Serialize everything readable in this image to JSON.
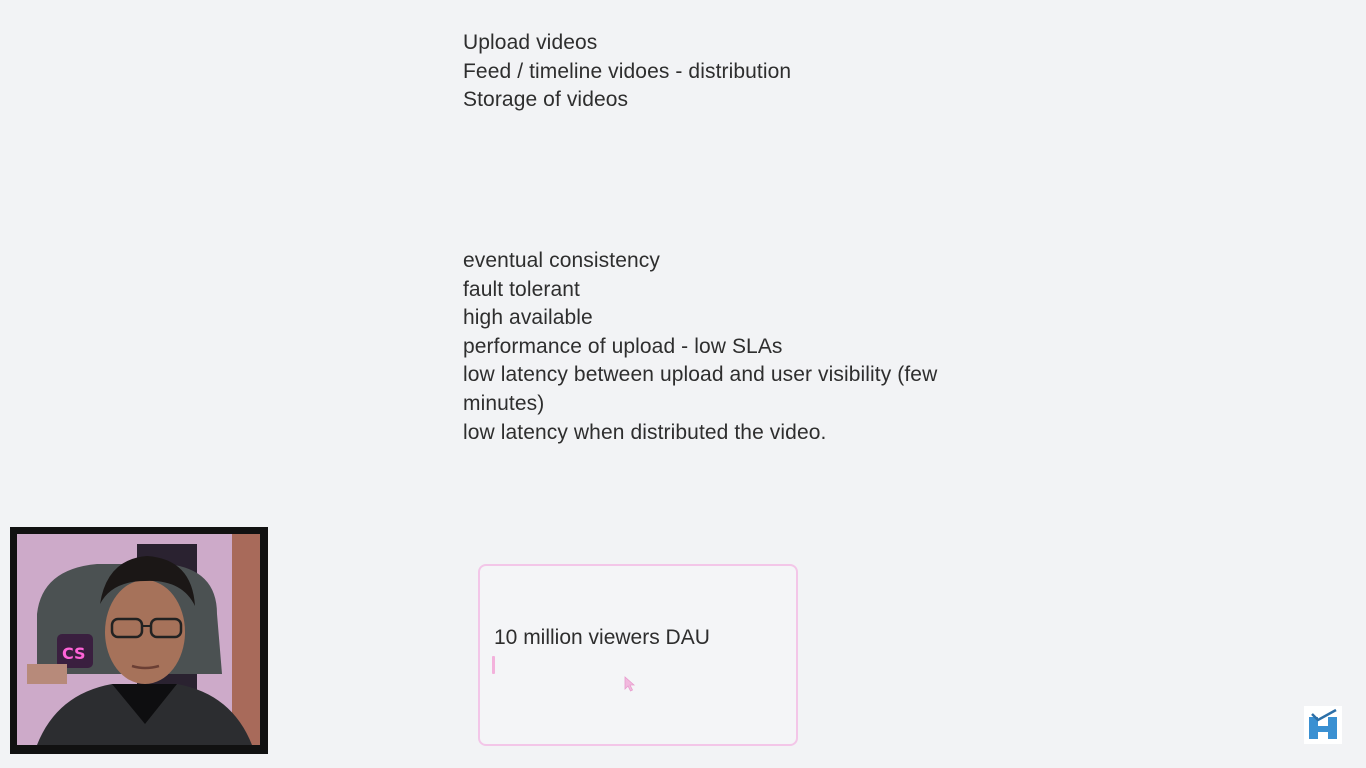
{
  "notes": {
    "features": [
      "Upload videos",
      "Feed / timeline vidoes - distribution",
      "Storage of videos"
    ],
    "requirements": [
      "eventual consistency",
      "fault tolerant",
      "high available",
      "performance of upload - low SLAs",
      "low latency between upload and user visibility  (few",
      "minutes)",
      "low latency when distributed the video."
    ]
  },
  "text_box": {
    "value": "10 million viewers DAU"
  },
  "icons": {
    "pointer": "mouse-pointer-icon",
    "watermark": "channel-logo-icon"
  },
  "colors": {
    "background": "#f2f3f5",
    "text": "#2e2e2e",
    "box_border": "#f3c6e8"
  }
}
